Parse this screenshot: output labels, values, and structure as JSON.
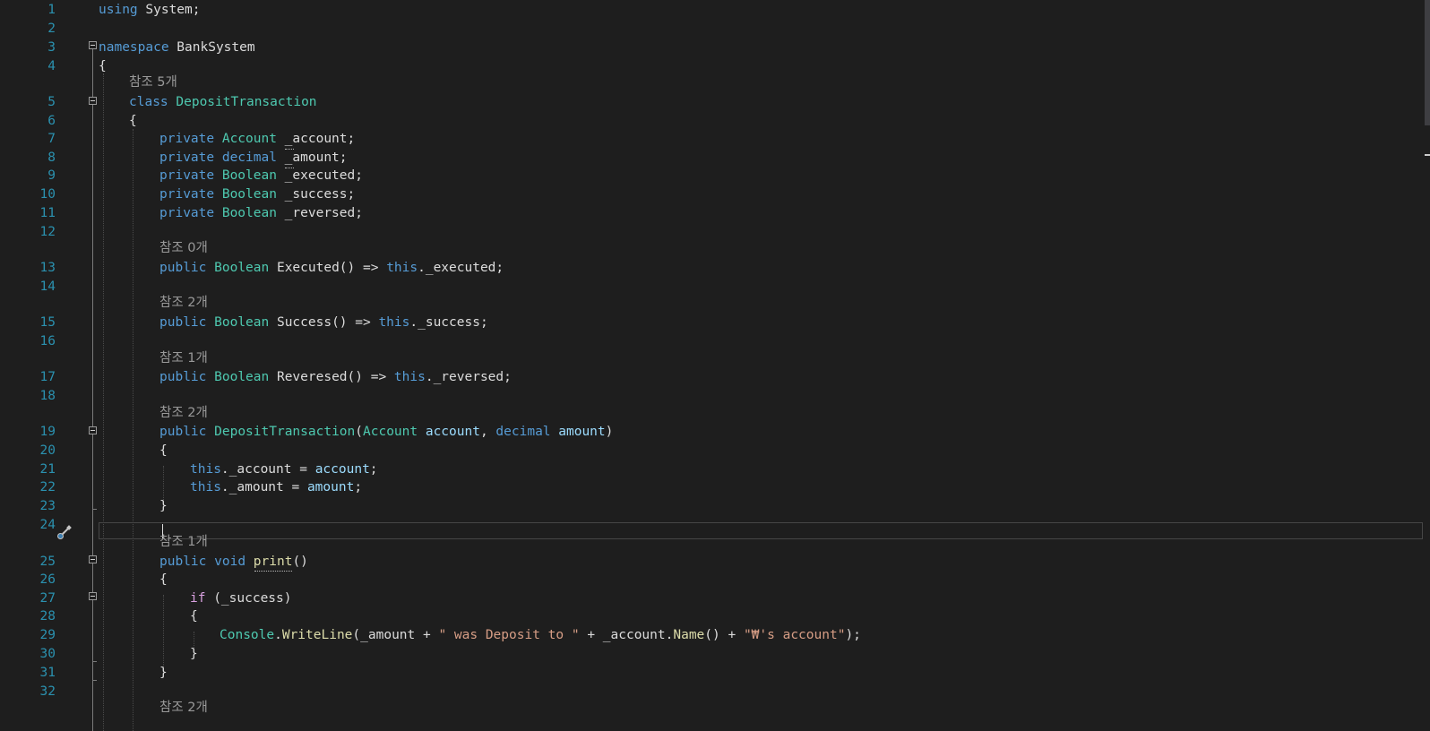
{
  "editor": {
    "language": "C#",
    "current_line": 24,
    "colors": {
      "background": "#1e1e1e",
      "line_number": "#2b91af",
      "keyword": "#569cd6",
      "type": "#4ec9b0",
      "string": "#d69d85",
      "parameter": "#9cdcfe",
      "method": "#dcdcaa",
      "default": "#dcdcdc",
      "codelens": "#999999"
    },
    "line_numbers": [
      "1",
      "2",
      "3",
      "4",
      "5",
      "6",
      "7",
      "8",
      "9",
      "10",
      "11",
      "12",
      "13",
      "14",
      "15",
      "16",
      "17",
      "18",
      "19",
      "20",
      "21",
      "22",
      "23",
      "24",
      "25",
      "26",
      "27",
      "28",
      "29",
      "30",
      "31",
      "32"
    ],
    "codelens": {
      "class": "참조 5개",
      "executed": "참조 0개",
      "success": "참조 2개",
      "reversed": "참조 1개",
      "ctor": "참조 2개",
      "print": "참조 1개",
      "next": "참조 2개"
    },
    "lines": {
      "l1": [
        {
          "k": "keyword",
          "t": "using"
        },
        {
          "k": "default",
          "t": " System;"
        }
      ],
      "l3": [
        {
          "k": "keyword",
          "t": "namespace"
        },
        {
          "k": "default",
          "t": " BankSystem"
        }
      ],
      "l4": [
        {
          "k": "default",
          "t": "{"
        }
      ],
      "l5": [
        {
          "k": "keyword",
          "t": "class"
        },
        {
          "k": "default",
          "t": " "
        },
        {
          "k": "type",
          "t": "DepositTransaction"
        }
      ],
      "l6": [
        {
          "k": "default",
          "t": "{"
        }
      ],
      "l7": [
        {
          "k": "keyword",
          "t": "private"
        },
        {
          "k": "default",
          "t": " "
        },
        {
          "k": "type",
          "t": "Account"
        },
        {
          "k": "default",
          "t": " _account;"
        }
      ],
      "l8": [
        {
          "k": "keyword",
          "t": "private"
        },
        {
          "k": "default",
          "t": " "
        },
        {
          "k": "keyword",
          "t": "decimal"
        },
        {
          "k": "default",
          "t": " _amount;"
        }
      ],
      "l9": [
        {
          "k": "keyword",
          "t": "private"
        },
        {
          "k": "default",
          "t": " "
        },
        {
          "k": "type",
          "t": "Boolean"
        },
        {
          "k": "default",
          "t": " _executed;"
        }
      ],
      "l10": [
        {
          "k": "keyword",
          "t": "private"
        },
        {
          "k": "default",
          "t": " "
        },
        {
          "k": "type",
          "t": "Boolean"
        },
        {
          "k": "default",
          "t": " _success;"
        }
      ],
      "l11": [
        {
          "k": "keyword",
          "t": "private"
        },
        {
          "k": "default",
          "t": " "
        },
        {
          "k": "type",
          "t": "Boolean"
        },
        {
          "k": "default",
          "t": " _reversed;"
        }
      ],
      "l13": [
        {
          "k": "keyword",
          "t": "public"
        },
        {
          "k": "default",
          "t": " "
        },
        {
          "k": "type",
          "t": "Boolean"
        },
        {
          "k": "default",
          "t": " Executed() => "
        },
        {
          "k": "keyword",
          "t": "this"
        },
        {
          "k": "default",
          "t": "._executed;"
        }
      ],
      "l15": [
        {
          "k": "keyword",
          "t": "public"
        },
        {
          "k": "default",
          "t": " "
        },
        {
          "k": "type",
          "t": "Boolean"
        },
        {
          "k": "default",
          "t": " Success() => "
        },
        {
          "k": "keyword",
          "t": "this"
        },
        {
          "k": "default",
          "t": "._success;"
        }
      ],
      "l17": [
        {
          "k": "keyword",
          "t": "public"
        },
        {
          "k": "default",
          "t": " "
        },
        {
          "k": "type",
          "t": "Boolean"
        },
        {
          "k": "default",
          "t": " Reveresed() => "
        },
        {
          "k": "keyword",
          "t": "this"
        },
        {
          "k": "default",
          "t": "._reversed;"
        }
      ],
      "l19": [
        {
          "k": "keyword",
          "t": "public"
        },
        {
          "k": "default",
          "t": " "
        },
        {
          "k": "type",
          "t": "DepositTransaction"
        },
        {
          "k": "default",
          "t": "("
        },
        {
          "k": "type",
          "t": "Account"
        },
        {
          "k": "default",
          "t": " "
        },
        {
          "k": "param",
          "t": "account"
        },
        {
          "k": "default",
          "t": ", "
        },
        {
          "k": "keyword",
          "t": "decimal"
        },
        {
          "k": "default",
          "t": " "
        },
        {
          "k": "param",
          "t": "amount"
        },
        {
          "k": "default",
          "t": ")"
        }
      ],
      "l20": [
        {
          "k": "default",
          "t": "{"
        }
      ],
      "l21": [
        {
          "k": "keyword",
          "t": "this"
        },
        {
          "k": "default",
          "t": "._account = "
        },
        {
          "k": "param",
          "t": "account"
        },
        {
          "k": "default",
          "t": ";"
        }
      ],
      "l22": [
        {
          "k": "keyword",
          "t": "this"
        },
        {
          "k": "default",
          "t": "._amount = "
        },
        {
          "k": "param",
          "t": "amount"
        },
        {
          "k": "default",
          "t": ";"
        }
      ],
      "l23": [
        {
          "k": "default",
          "t": "}"
        }
      ],
      "l25": [
        {
          "k": "keyword",
          "t": "public"
        },
        {
          "k": "default",
          "t": " "
        },
        {
          "k": "keyword",
          "t": "void"
        },
        {
          "k": "default",
          "t": " "
        },
        {
          "k": "method",
          "t": "print"
        },
        {
          "k": "default",
          "t": "()"
        }
      ],
      "l26": [
        {
          "k": "default",
          "t": "{"
        }
      ],
      "l27": [
        {
          "k": "control",
          "t": "if"
        },
        {
          "k": "default",
          "t": " (_success)"
        }
      ],
      "l28": [
        {
          "k": "default",
          "t": "{"
        }
      ],
      "l29": [
        {
          "k": "type",
          "t": "Console"
        },
        {
          "k": "default",
          "t": "."
        },
        {
          "k": "method",
          "t": "WriteLine"
        },
        {
          "k": "default",
          "t": "(_amount + "
        },
        {
          "k": "string",
          "t": "\" was Deposit to \""
        },
        {
          "k": "default",
          "t": " + _account."
        },
        {
          "k": "method",
          "t": "Name"
        },
        {
          "k": "default",
          "t": "() + "
        },
        {
          "k": "string",
          "t": "\"₩'s account\""
        },
        {
          "k": "default",
          "t": ");"
        }
      ],
      "l30": [
        {
          "k": "default",
          "t": "}"
        }
      ],
      "l31": [
        {
          "k": "default",
          "t": "}"
        }
      ]
    }
  }
}
